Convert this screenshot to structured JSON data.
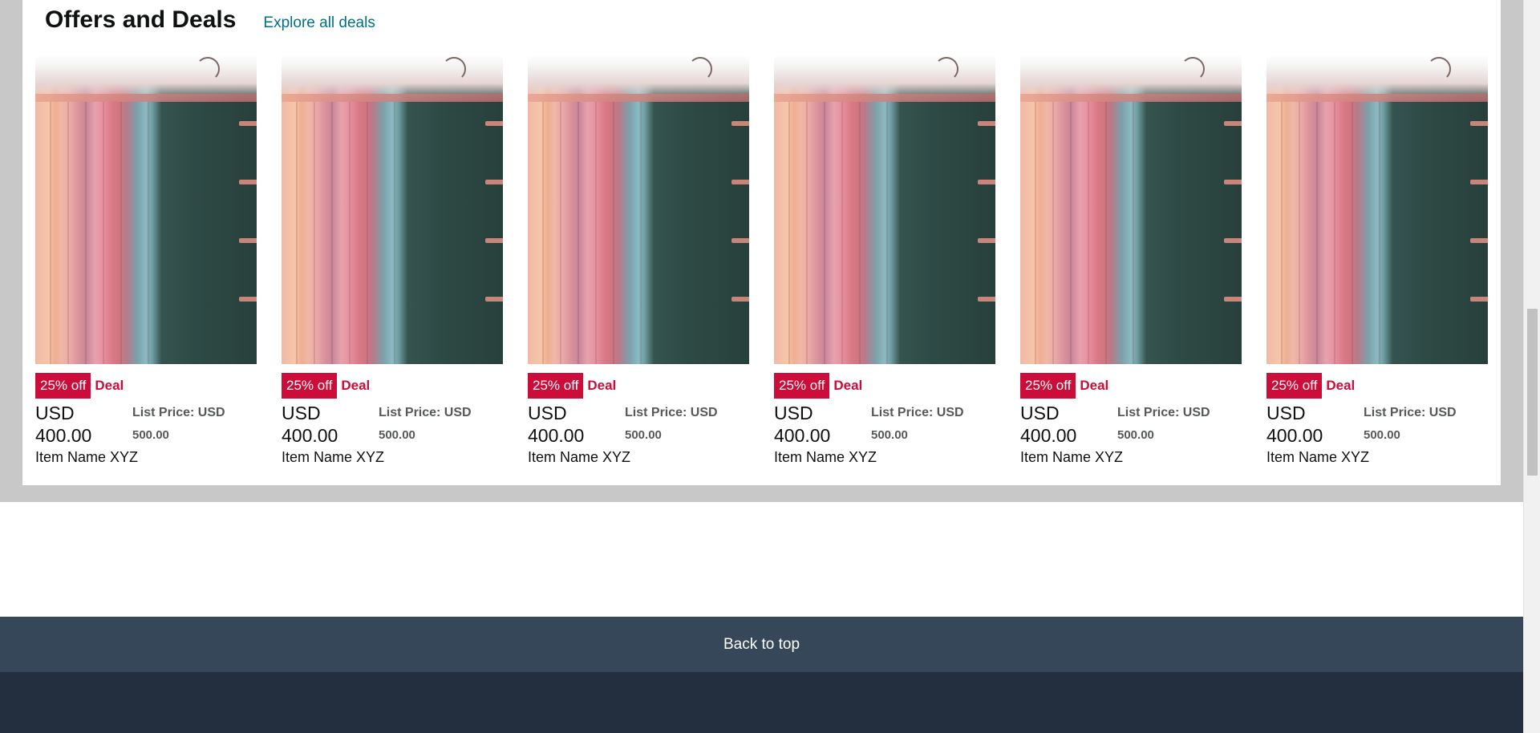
{
  "deals": {
    "title": "Offers and Deals",
    "explore_link": "Explore all deals",
    "products": [
      {
        "discount": "25% off",
        "deal_label": "Deal",
        "currency": "USD",
        "price": "400.00",
        "list_price_label": "List Price: USD",
        "list_price": "500.00",
        "name": "Item Name XYZ"
      },
      {
        "discount": "25% off",
        "deal_label": "Deal",
        "currency": "USD",
        "price": "400.00",
        "list_price_label": "List Price: USD",
        "list_price": "500.00",
        "name": "Item Name XYZ"
      },
      {
        "discount": "25% off",
        "deal_label": "Deal",
        "currency": "USD",
        "price": "400.00",
        "list_price_label": "List Price: USD",
        "list_price": "500.00",
        "name": "Item Name XYZ"
      },
      {
        "discount": "25% off",
        "deal_label": "Deal",
        "currency": "USD",
        "price": "400.00",
        "list_price_label": "List Price: USD",
        "list_price": "500.00",
        "name": "Item Name XYZ"
      },
      {
        "discount": "25% off",
        "deal_label": "Deal",
        "currency": "USD",
        "price": "400.00",
        "list_price_label": "List Price: USD",
        "list_price": "500.00",
        "name": "Item Name XYZ"
      },
      {
        "discount": "25% off",
        "deal_label": "Deal",
        "currency": "USD",
        "price": "400.00",
        "list_price_label": "List Price: USD",
        "list_price": "500.00",
        "name": "Item Name XYZ"
      }
    ]
  },
  "footer": {
    "back_to_top": "Back to top"
  },
  "colors": {
    "deal_red": "#cc0c39",
    "link_teal": "#007185",
    "back_to_top_bg": "#37475a",
    "footer_bg": "#232f3e"
  }
}
